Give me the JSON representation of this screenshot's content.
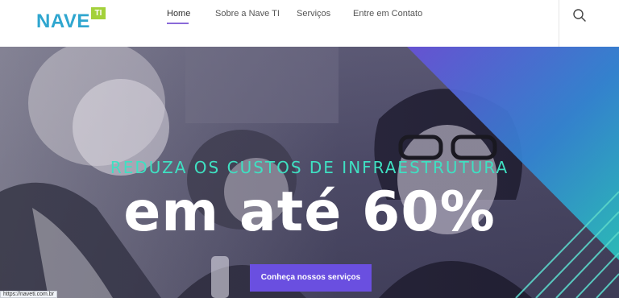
{
  "header": {
    "logo": {
      "name": "NAVE",
      "badge": "TI"
    },
    "nav": [
      {
        "label": "Home",
        "active": true
      },
      {
        "label": "Sobre a Nave TI",
        "active": false
      },
      {
        "label": "Serviços",
        "active": false
      },
      {
        "label": "Entre em Contato",
        "active": false
      }
    ],
    "search_icon": "search-icon"
  },
  "hero": {
    "tagline": "REDUZA OS CUSTOS DE INFRAESTRUTURA",
    "headline": "em até 60%",
    "cta_label": "Conheça nossos serviços"
  },
  "status_bar": {
    "url": "https://naveti.com.br"
  },
  "colors": {
    "brand_blue": "#2fa6cf",
    "brand_green": "#a3d13a",
    "accent_purple": "#6a4fe0",
    "tagline_teal": "#3fe0c2"
  }
}
